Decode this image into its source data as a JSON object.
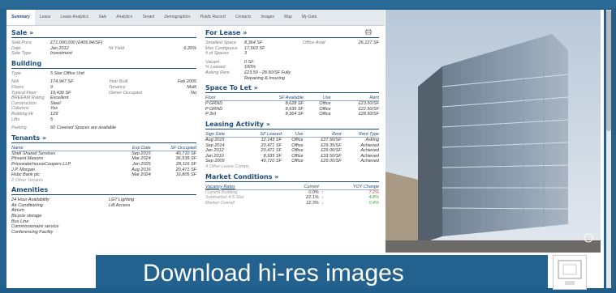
{
  "tabs": [
    "Summary",
    "Lease",
    "Lease Analytics",
    "Sale",
    "Analytics",
    "Tenant",
    "Demographics",
    "Public Record",
    "Contacts",
    "Images",
    "Map",
    "My Data"
  ],
  "sale": {
    "title": "Sale »",
    "rows": [
      {
        "label": "Sold Price",
        "value": "£71,000,000 (£405.84/SF)",
        "label2": "",
        "value2": ""
      },
      {
        "label": "Date",
        "value": "Jan 2012",
        "label2": "Nt Yield",
        "value2": "6.20%"
      },
      {
        "label": "Sale Type",
        "value": "Investment",
        "label2": "",
        "value2": ""
      }
    ]
  },
  "building": {
    "title": "Building",
    "type_label": "Type",
    "type_value": "5 Star Office Unit",
    "rows": [
      {
        "label": "NIA",
        "value": "174,947 SF",
        "label2": "Year Built",
        "value2": "Feb 2005"
      },
      {
        "label": "Floors",
        "value": "9",
        "label2": "Tenancy",
        "value2": "Multi"
      },
      {
        "label": "Typical Floor",
        "value": "19,439 SF",
        "label2": "Owner Occupied",
        "value2": "No"
      },
      {
        "label": "BREEAM Rating",
        "value": "Excellent",
        "label2": "",
        "value2": ""
      },
      {
        "label": "Construction",
        "value": "Steel",
        "label2": "",
        "value2": ""
      },
      {
        "label": "Columns",
        "value": "Yes",
        "label2": "",
        "value2": ""
      },
      {
        "label": "Building Ht",
        "value": "129'",
        "label2": "",
        "value2": ""
      },
      {
        "label": "Lifts",
        "value": "5",
        "label2": "",
        "value2": ""
      }
    ],
    "parking_label": "Parking",
    "parking_value": "60 Covered Spaces are available"
  },
  "tenants": {
    "title": "Tenants »",
    "headers": [
      "Name",
      "Exp Date",
      "SF Occupied"
    ],
    "rows": [
      [
        "Shell Shared Services",
        "Sep 2015",
        "40,710 SF"
      ],
      [
        "Pinsent Masons",
        "Mar 2024",
        "36,539 SF"
      ],
      [
        "PricewaterhouseCoopers LLP",
        "Jan 2025",
        "28,116 SF"
      ],
      [
        "J.P. Morgan",
        "Aug 2016",
        "20,471 SF"
      ],
      [
        "Hsbc Bank plc",
        "Mar 2024",
        "16,805 SF"
      ]
    ],
    "more": "2 Other Tenants"
  },
  "amenities": {
    "title": "Amenities",
    "col1": [
      "24 Hour Availability",
      "Air Conditioning",
      "Atrium",
      "Bicycle storage",
      "Bus Line",
      "Commissionaire service",
      "Conferencing Facility"
    ],
    "col2": [
      "LG7 Lighting",
      "Lift Access"
    ]
  },
  "forlease": {
    "title": "For Lease »",
    "rows": [
      {
        "label": "Smallest Space",
        "value": "8,364 SF",
        "label2": "Office Avail",
        "value2": "26,127 SF"
      },
      {
        "label": "Max Contiguous",
        "value": "17,563 SF",
        "label2": "",
        "value2": ""
      },
      {
        "label": "# of Spaces",
        "value": "3",
        "label2": "",
        "value2": ""
      }
    ],
    "rows2": [
      {
        "label": "Vacant",
        "value": "0 SF"
      },
      {
        "label": "% Leased",
        "value": "100%"
      },
      {
        "label": "Asking Rent",
        "value": "£23.50 - 28.50/SF Fully Repairing & Insuring"
      }
    ]
  },
  "spacetolet": {
    "title": "Space To Let »",
    "headers": [
      "Floor",
      "SF Available",
      "Use",
      "Rent"
    ],
    "rows": [
      [
        "P GRND",
        "8,628 SF",
        "Office",
        "£23.50/SF"
      ],
      [
        "P GRND",
        "8,935 SF",
        "Office",
        "£22.50/SF"
      ],
      [
        "P 3rd",
        "8,364 SF",
        "Office",
        "£28.50/SF"
      ]
    ]
  },
  "leasing": {
    "title": "Leasing Activity »",
    "headers": [
      "Sign Date",
      "SF Leased",
      "Use",
      "Rent",
      "Rent Type"
    ],
    "rows": [
      [
        "Aug 2015",
        "12,143 SF",
        "Office",
        "£27.50/SF",
        "Asking"
      ],
      [
        "Sep 2014",
        "20,471 SF",
        "Office",
        "£29.35/SF",
        "Achieved"
      ],
      [
        "Jan 2012",
        "20,471 SF",
        "Office",
        "£29.00/SF",
        "Achieved"
      ],
      [
        "Jan 2010",
        "8,935 SF",
        "Office",
        "£33.50/SF",
        "Achieved"
      ],
      [
        "Sep 2009",
        "40,710 SF",
        "Office",
        "£29.00/SF",
        "Achieved"
      ]
    ],
    "more": "4 Other Lease Comps"
  },
  "market": {
    "title": "Market Conditions »",
    "headers": [
      "Vacancy Rates",
      "Current",
      "YOY Change"
    ],
    "rows": [
      {
        "name": "Current Building",
        "current": "0.0%",
        "change": "7.2%",
        "dir": "up"
      },
      {
        "name": "Submarket 4-5 Star",
        "current": "21.1%",
        "change": "4.8%",
        "dir": "down"
      },
      {
        "name": "Market Overall",
        "current": "12.3%",
        "change": "0.4%",
        "dir": "down"
      }
    ]
  },
  "banner": {
    "text": "Download hi-res images"
  },
  "colors": {
    "accent": "#1e4d7b",
    "background": "#23628f",
    "up": "#dd3333",
    "down": "#33aa33"
  }
}
